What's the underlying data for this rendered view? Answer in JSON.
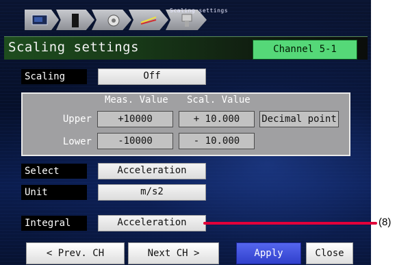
{
  "nav": {
    "caption": "Scaling settings",
    "steps": [
      {
        "icon": "monitor-icon"
      },
      {
        "icon": "module-icon"
      },
      {
        "icon": "gear-icon"
      },
      {
        "icon": "wrench-icon"
      },
      {
        "icon": "input-terminal-icon"
      }
    ]
  },
  "header": {
    "title": "Scaling settings",
    "channel": "Channel 5-1"
  },
  "scaling": {
    "label": "Scaling",
    "value": "Off"
  },
  "panel": {
    "col_meas": "Meas. Value",
    "col_scal": "Scal. Value",
    "upper_label": "Upper",
    "lower_label": "Lower",
    "upper_meas": "+10000",
    "upper_scal": "+ 10.000",
    "lower_meas": "-10000",
    "lower_scal": "- 10.000",
    "decimal_point": "Decimal point"
  },
  "select": {
    "label": "Select",
    "value": "Acceleration"
  },
  "unit": {
    "label": "Unit",
    "value": "m/s2"
  },
  "integral": {
    "label": "Integral",
    "value": "Acceleration"
  },
  "buttons": {
    "prev": "< Prev. CH",
    "next": "Next CH >",
    "apply": "Apply",
    "close": "Close"
  },
  "callout": {
    "label": "(8)"
  },
  "colors": {
    "title_green": "#55d878",
    "apply_blue": "#3040cc",
    "callout_red": "#e2003a"
  }
}
